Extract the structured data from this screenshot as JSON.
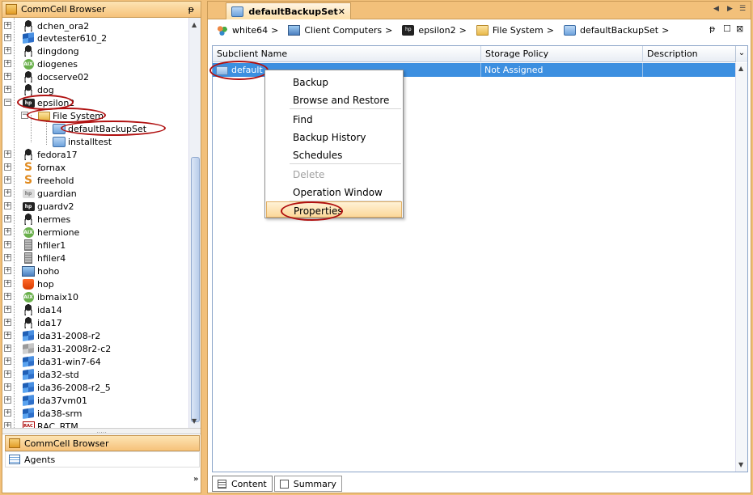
{
  "left_panel": {
    "title": "CommCell Browser",
    "pin_glyph": "ᵽ",
    "tree": [
      {
        "label": "dchen_ora2",
        "icon": "linux"
      },
      {
        "label": "devtester610_2",
        "icon": "windows"
      },
      {
        "label": "dingdong",
        "icon": "linux"
      },
      {
        "label": "diogenes",
        "icon": "aix"
      },
      {
        "label": "docserve02",
        "icon": "linux"
      },
      {
        "label": "dog",
        "icon": "linux"
      },
      {
        "label": "epsilon2",
        "icon": "hp"
      },
      {
        "label": "File System",
        "icon": "folder"
      },
      {
        "label": "defaultBackupSet",
        "icon": "backupset"
      },
      {
        "label": "installtest",
        "icon": "backupset"
      },
      {
        "label": "fedora17",
        "icon": "linux"
      },
      {
        "label": "fornax",
        "icon": "solaris"
      },
      {
        "label": "freehold",
        "icon": "solaris"
      },
      {
        "label": "guardian",
        "icon": "hp-gray"
      },
      {
        "label": "guardv2",
        "icon": "hp"
      },
      {
        "label": "hermes",
        "icon": "linux"
      },
      {
        "label": "hermione",
        "icon": "aix"
      },
      {
        "label": "hfiler1",
        "icon": "server"
      },
      {
        "label": "hfiler4",
        "icon": "server"
      },
      {
        "label": "hoho",
        "icon": "computers"
      },
      {
        "label": "hop",
        "icon": "bucket"
      },
      {
        "label": "ibmaix10",
        "icon": "aix"
      },
      {
        "label": "ida14",
        "icon": "linux"
      },
      {
        "label": "ida17",
        "icon": "linux"
      },
      {
        "label": "ida31-2008-r2",
        "icon": "windows"
      },
      {
        "label": "ida31-2008r2-c2",
        "icon": "windows-gray"
      },
      {
        "label": "ida31-win7-64",
        "icon": "windows"
      },
      {
        "label": "ida32-std",
        "icon": "windows"
      },
      {
        "label": "ida36-2008-r2_5",
        "icon": "windows"
      },
      {
        "label": "ida37vm01",
        "icon": "windows"
      },
      {
        "label": "ida38-srm",
        "icon": "windows"
      },
      {
        "label": "RAC_RTM",
        "icon": "cluster"
      }
    ],
    "nav": [
      {
        "label": "CommCell Browser"
      },
      {
        "label": "Agents"
      }
    ]
  },
  "tab": {
    "title": "defaultBackupSet",
    "close": "✕"
  },
  "breadcrumb": [
    {
      "label": "white64"
    },
    {
      "label": "Client Computers"
    },
    {
      "label": "epsilon2"
    },
    {
      "label": "File System"
    },
    {
      "label": "defaultBackupSet"
    }
  ],
  "breadcrumb_sep": ">",
  "grid": {
    "columns": [
      "Subclient Name",
      "Storage Policy",
      "Description"
    ],
    "rows": [
      {
        "name": "default",
        "storage_policy": "Not Assigned",
        "description": ""
      }
    ]
  },
  "context_menu": {
    "items": [
      "Backup",
      "Browse and Restore",
      "Find",
      "Backup History",
      "Schedules",
      "Delete",
      "Operation Window",
      "Properties"
    ]
  },
  "bottom_tabs": [
    "Content",
    "Summary"
  ]
}
